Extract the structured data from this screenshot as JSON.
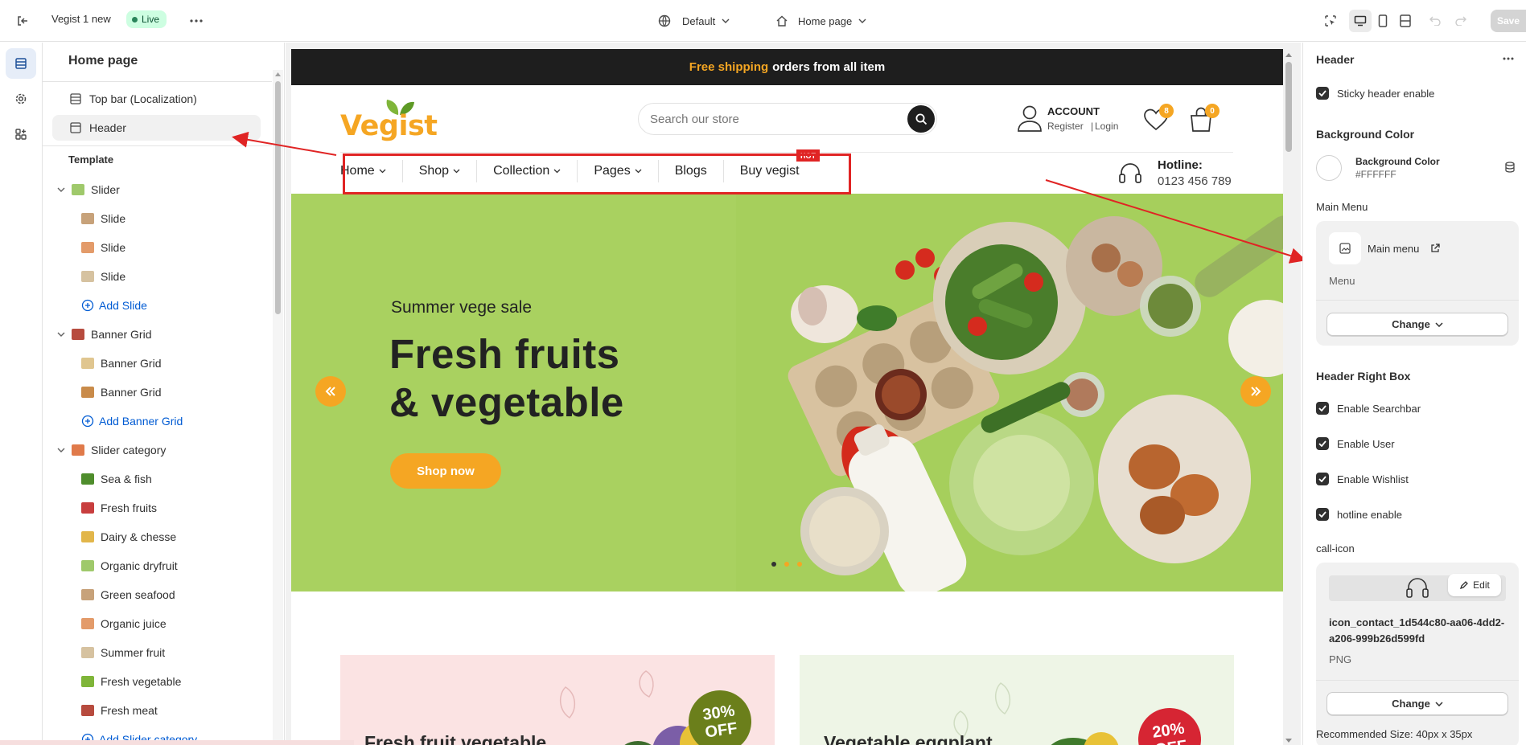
{
  "topbar": {
    "theme_name": "Vegist 1 new",
    "live_badge": "Live",
    "device_select": "Default",
    "page_select": "Home page",
    "save_label": "Save"
  },
  "sidebar": {
    "title": "Home page",
    "header_items": [
      {
        "label": "Top bar (Localization)"
      },
      {
        "label": "Header"
      }
    ],
    "template_label": "Template",
    "tree": [
      {
        "label": "Slider",
        "level": 0,
        "expandable": true
      },
      {
        "label": "Slide",
        "level": 1
      },
      {
        "label": "Slide",
        "level": 1
      },
      {
        "label": "Slide",
        "level": 1
      },
      {
        "label": "Add Slide",
        "level": 1,
        "add": true
      },
      {
        "label": "Banner Grid",
        "level": 0,
        "expandable": true
      },
      {
        "label": "Banner Grid",
        "level": 1
      },
      {
        "label": "Banner Grid",
        "level": 1
      },
      {
        "label": "Add Banner Grid",
        "level": 1,
        "add": true
      },
      {
        "label": "Slider category",
        "level": 0,
        "expandable": true
      },
      {
        "label": "Sea & fish",
        "level": 1
      },
      {
        "label": "Fresh fruits",
        "level": 1
      },
      {
        "label": "Dairy & chesse",
        "level": 1
      },
      {
        "label": "Organic dryfruit",
        "level": 1
      },
      {
        "label": "Green seafood",
        "level": 1
      },
      {
        "label": "Organic juice",
        "level": 1
      },
      {
        "label": "Summer fruit",
        "level": 1
      },
      {
        "label": "Fresh vegetable",
        "level": 1
      },
      {
        "label": "Fresh meat",
        "level": 1
      },
      {
        "label": "Add Slider category",
        "level": 1,
        "add": true
      }
    ]
  },
  "store": {
    "announcement_highlight": "Free shipping",
    "announcement_rest": "orders from all item",
    "logo": "Vegist",
    "search_placeholder": "Search our store",
    "account_title": "ACCOUNT",
    "account_register": "Register",
    "account_login": "Login",
    "wishlist_count": "8",
    "cart_count": "0",
    "nav": [
      "Home",
      "Shop",
      "Collection",
      "Pages",
      "Blogs",
      "Buy vegist"
    ],
    "hot_badge": "HOT",
    "hotline_title": "Hotline:",
    "hotline_number": "0123 456 789",
    "hero_kicker": "Summer vege sale",
    "hero_title_1": "Fresh fruits",
    "hero_title_2": "& vegetable",
    "hero_button": "Shop now",
    "banner1_title": "Fresh fruit vegetable",
    "banner1_badge_1": "30%",
    "banner1_badge_2": "OFF",
    "banner2_title": "Vegetable eggplant",
    "banner2_badge_1": "20%",
    "banner2_badge_2": "OFF"
  },
  "panel": {
    "title": "Header",
    "sticky_label": "Sticky header enable",
    "bg_section": "Background Color",
    "bg_label": "Background Color",
    "bg_value": "#FFFFFF",
    "main_menu_section": "Main Menu",
    "menu_name": "Main menu",
    "menu_sub": "Menu",
    "change_label": "Change",
    "right_box_section": "Header Right Box",
    "toggles": [
      {
        "label": "Enable Searchbar"
      },
      {
        "label": "Enable User"
      },
      {
        "label": "Enable Wishlist"
      },
      {
        "label": "hotline enable"
      }
    ],
    "call_icon_section": "call-icon",
    "edit_label": "Edit",
    "file_name": "icon_contact_1d544c80-aa06-4dd2-a206-999b26d599fd",
    "file_type": "PNG",
    "change_label_2": "Change",
    "recommended": "Recommended Size: 40px x 35px"
  },
  "colors": {
    "accent_orange": "#f5a623",
    "hero_green": "#a9d160",
    "annotation_red": "#e02424",
    "link_blue": "#005bd3"
  }
}
